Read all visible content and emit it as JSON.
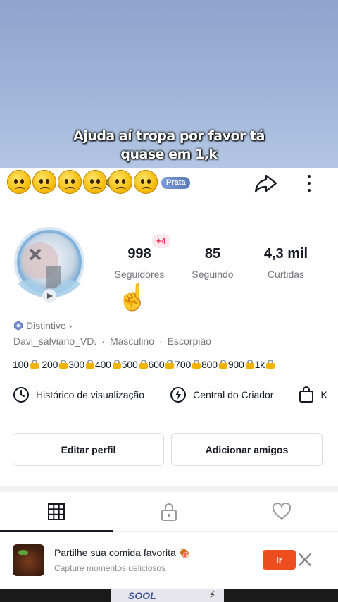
{
  "caption": {
    "line1": "Ajuda  aí tropa por favor tá",
    "line2": "quase em 1,k"
  },
  "header": {
    "username_fragment": "@",
    "badge_label": "Prata",
    "reaction_emoji_count": 6
  },
  "stats": {
    "followers": {
      "value": "998",
      "label": "Seguidores",
      "delta": "+4"
    },
    "following": {
      "value": "85",
      "label": "Seguindo"
    },
    "likes": {
      "value": "4,3 mil",
      "label": "Curtidas"
    }
  },
  "profile": {
    "badge_link": "Distintivo",
    "handle": "Davi_salviano_VD.",
    "separator": "·",
    "gender": "Masculino",
    "zodiac": "Escorpião",
    "bio_steps": [
      "100",
      "200",
      "300",
      "400",
      "500",
      "600",
      "700",
      "800",
      "900",
      "1k"
    ]
  },
  "quick_links": {
    "history": "Histórico de visualização",
    "creator": "Central do Criador",
    "shop": "K"
  },
  "buttons": {
    "edit": "Editar perfil",
    "add_friends": "Adicionar amigos"
  },
  "tabs": [
    {
      "icon": "grid-icon",
      "active": true
    },
    {
      "icon": "lock-icon",
      "active": false
    },
    {
      "icon": "heart-icon",
      "active": false
    }
  ],
  "ad": {
    "title": "Partilhe sua comida favorita",
    "subtitle": "Capture momentos deliciosos",
    "cta": "Ir"
  },
  "bottom_preview": {
    "text": "SOOL"
  },
  "colors": {
    "accent": "#fe2c55",
    "ad_cta": "#ee4d1f",
    "badge": "#6a89c7"
  }
}
